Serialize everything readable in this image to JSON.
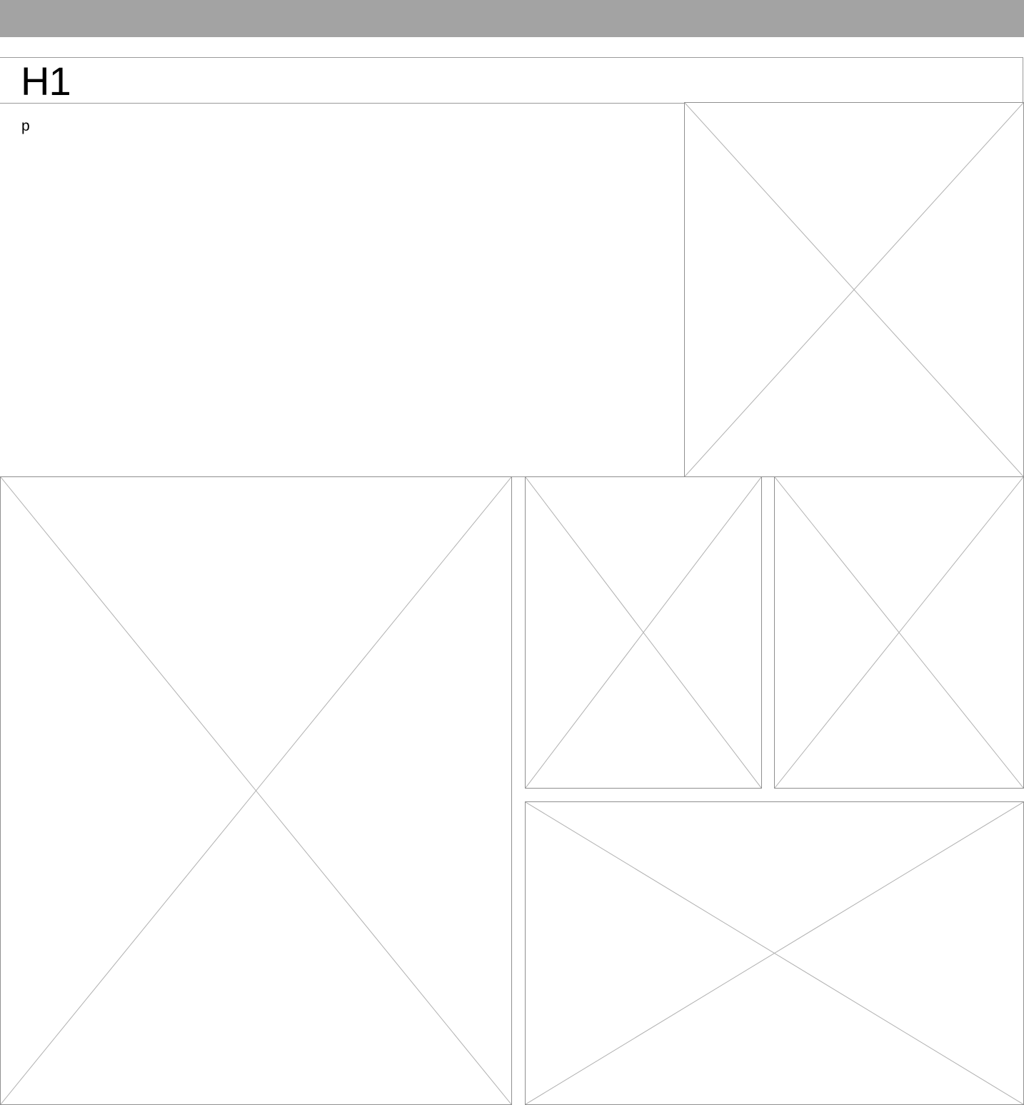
{
  "header": {
    "title": "H1"
  },
  "content": {
    "paragraph": "p"
  },
  "colors": {
    "topbar": "#a3a3a3",
    "border": "#9a9a9a",
    "placeholder_cross": "#b0b0b0"
  },
  "placeholders": [
    {
      "icon": "image-placeholder-icon"
    },
    {
      "icon": "image-placeholder-icon"
    },
    {
      "icon": "image-placeholder-icon"
    },
    {
      "icon": "image-placeholder-icon"
    },
    {
      "icon": "image-placeholder-icon"
    }
  ]
}
